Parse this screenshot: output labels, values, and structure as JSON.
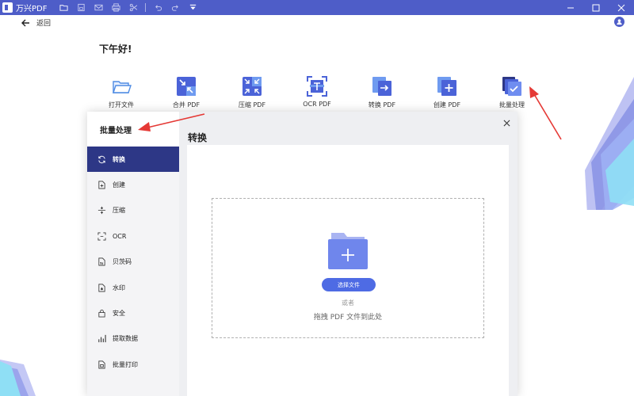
{
  "app": {
    "title": "万兴PDF"
  },
  "back": {
    "label": "返回"
  },
  "greeting": "下午好!",
  "tools": [
    {
      "label": "打开文件",
      "icon": "folder-open-icon"
    },
    {
      "label": "合并 PDF",
      "icon": "merge-pdf-icon"
    },
    {
      "label": "压缩 PDF",
      "icon": "compress-pdf-icon"
    },
    {
      "label": "OCR PDF",
      "icon": "ocr-pdf-icon"
    },
    {
      "label": "转换 PDF",
      "icon": "convert-pdf-icon"
    },
    {
      "label": "创建 PDF",
      "icon": "create-pdf-icon"
    },
    {
      "label": "批量处理",
      "icon": "batch-process-icon"
    }
  ],
  "modal": {
    "sidebar_title": "批量处理",
    "items": [
      {
        "label": "转换",
        "icon": "refresh-icon",
        "active": true
      },
      {
        "label": "创建",
        "icon": "file-plus-icon"
      },
      {
        "label": "压缩",
        "icon": "compress-icon"
      },
      {
        "label": "OCR",
        "icon": "scan-icon"
      },
      {
        "label": "贝茨码",
        "icon": "bates-icon"
      },
      {
        "label": "水印",
        "icon": "watermark-icon"
      },
      {
        "label": "安全",
        "icon": "lock-icon"
      },
      {
        "label": "提取数据",
        "icon": "bar-chart-icon"
      },
      {
        "label": "批量打印",
        "icon": "print-icon"
      }
    ],
    "main_title": "转换",
    "select_button": "选择文件",
    "or_text": "或者",
    "drag_text": "拖拽 PDF 文件到此处"
  },
  "colors": {
    "titlebar": "#4e5dc8",
    "sidebar_active": "#2d3786",
    "primary_button": "#4e6be4",
    "annotation_arrow": "#e53935"
  }
}
